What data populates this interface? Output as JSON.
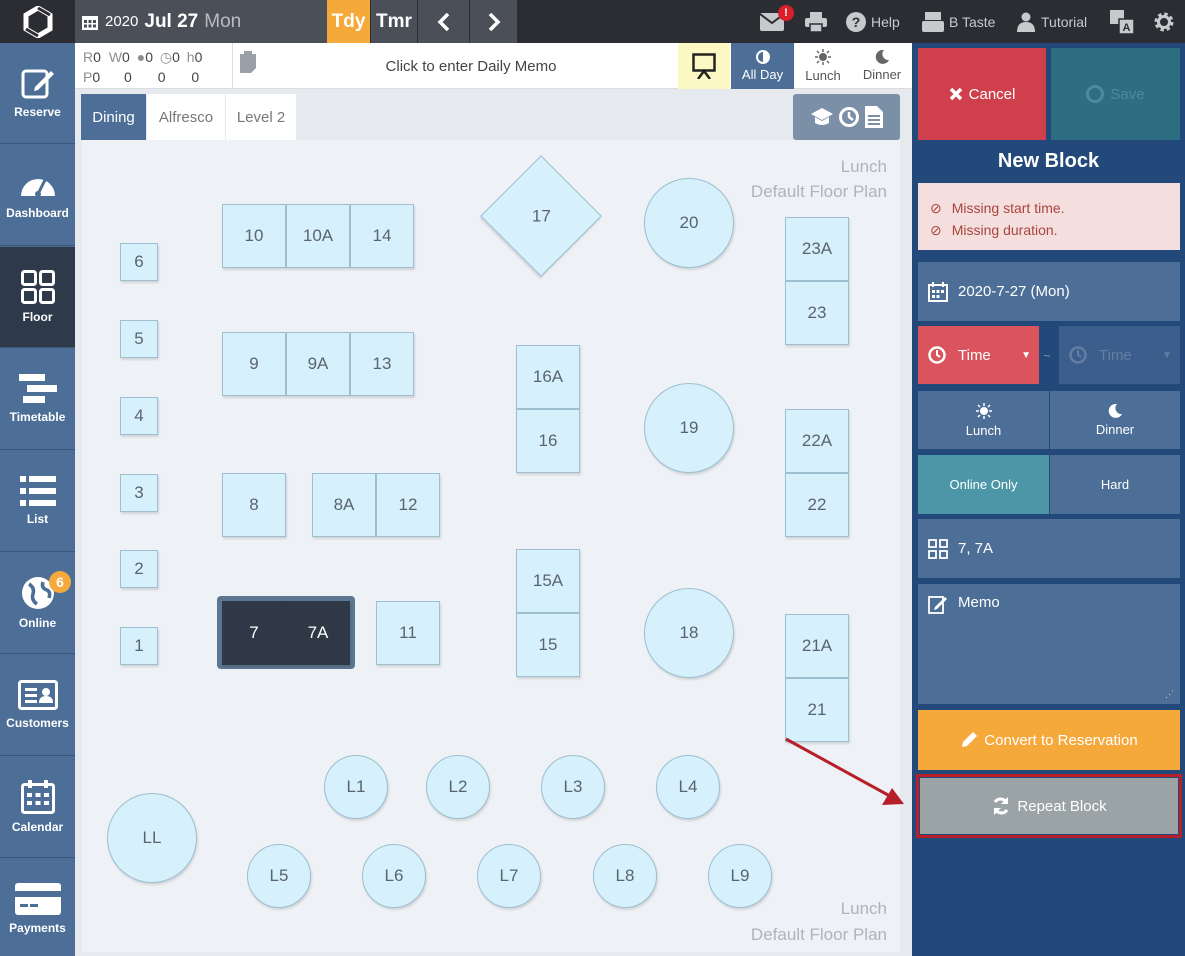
{
  "topbar": {
    "year": "2020",
    "date": "Jul 27",
    "weekday": "Mon",
    "today": "Tdy",
    "tomorrow": "Tmr",
    "notification_badge": "!",
    "help": "Help",
    "store": "B Taste",
    "tutorial": "Tutorial"
  },
  "sidebar": [
    {
      "label": "Reserve",
      "icon": "edit-icon"
    },
    {
      "label": "Dashboard",
      "icon": "gauge-icon"
    },
    {
      "label": "Floor",
      "icon": "grid-icon"
    },
    {
      "label": "Timetable",
      "icon": "timetable-icon"
    },
    {
      "label": "List",
      "icon": "list-icon"
    },
    {
      "label": "Online",
      "icon": "globe-icon",
      "badge": "6"
    },
    {
      "label": "Customers",
      "icon": "id-card-icon"
    },
    {
      "label": "Calendar",
      "icon": "calendar-icon"
    },
    {
      "label": "Payments",
      "icon": "credit-card-icon"
    }
  ],
  "stats": {
    "r_label": "R",
    "r_value": "0",
    "w_label": "W",
    "w_value": "0",
    "p_label": "P",
    "p_value": "0",
    "zeros": [
      "0",
      "0",
      "0"
    ],
    "row2": [
      "0",
      "0",
      "0",
      "0"
    ]
  },
  "memo_prompt": "Click to enter Daily Memo",
  "periods": [
    "All Day",
    "Lunch",
    "Dinner"
  ],
  "tabs": [
    "Dining",
    "Alfresco",
    "Level 2"
  ],
  "floor": {
    "label_top_1": "Lunch",
    "label_top_2": "Default Floor Plan",
    "label_bottom_1": "Lunch",
    "label_bottom_2": "Default Floor Plan",
    "tables": [
      "6",
      "5",
      "4",
      "3",
      "2",
      "1",
      "10",
      "10A",
      "14",
      "9",
      "9A",
      "13",
      "8",
      "8A",
      "12",
      "7",
      "7A",
      "11",
      "17",
      "16A",
      "16",
      "15A",
      "15",
      "20",
      "19",
      "18",
      "23A",
      "23",
      "22A",
      "22",
      "21A",
      "21",
      "LL",
      "L1",
      "L2",
      "L3",
      "L4",
      "L5",
      "L6",
      "L7",
      "L8",
      "L9"
    ],
    "selected": [
      "7",
      "7A"
    ]
  },
  "panel": {
    "cancel": "Cancel",
    "save": "Save",
    "title": "New Block",
    "errors": [
      "Missing start time.",
      "Missing duration."
    ],
    "date": "2020-7-27 (Mon)",
    "time_start": "Time",
    "tilde": "~",
    "time_end": "Time",
    "lunch": "Lunch",
    "dinner": "Dinner",
    "online_only": "Online Only",
    "hard": "Hard",
    "tables": "7, 7A",
    "memo": "Memo",
    "convert": "Convert to Reservation",
    "repeat": "Repeat Block"
  },
  "colors": {
    "sidebar": "#4c6e97",
    "panel": "#23487a",
    "cancel": "#d0404c",
    "save": "#2e6e82",
    "convert": "#f6a93b",
    "repeat": "#9aa4a6",
    "highlight": "#b7202a",
    "today": "#f6a93b"
  }
}
